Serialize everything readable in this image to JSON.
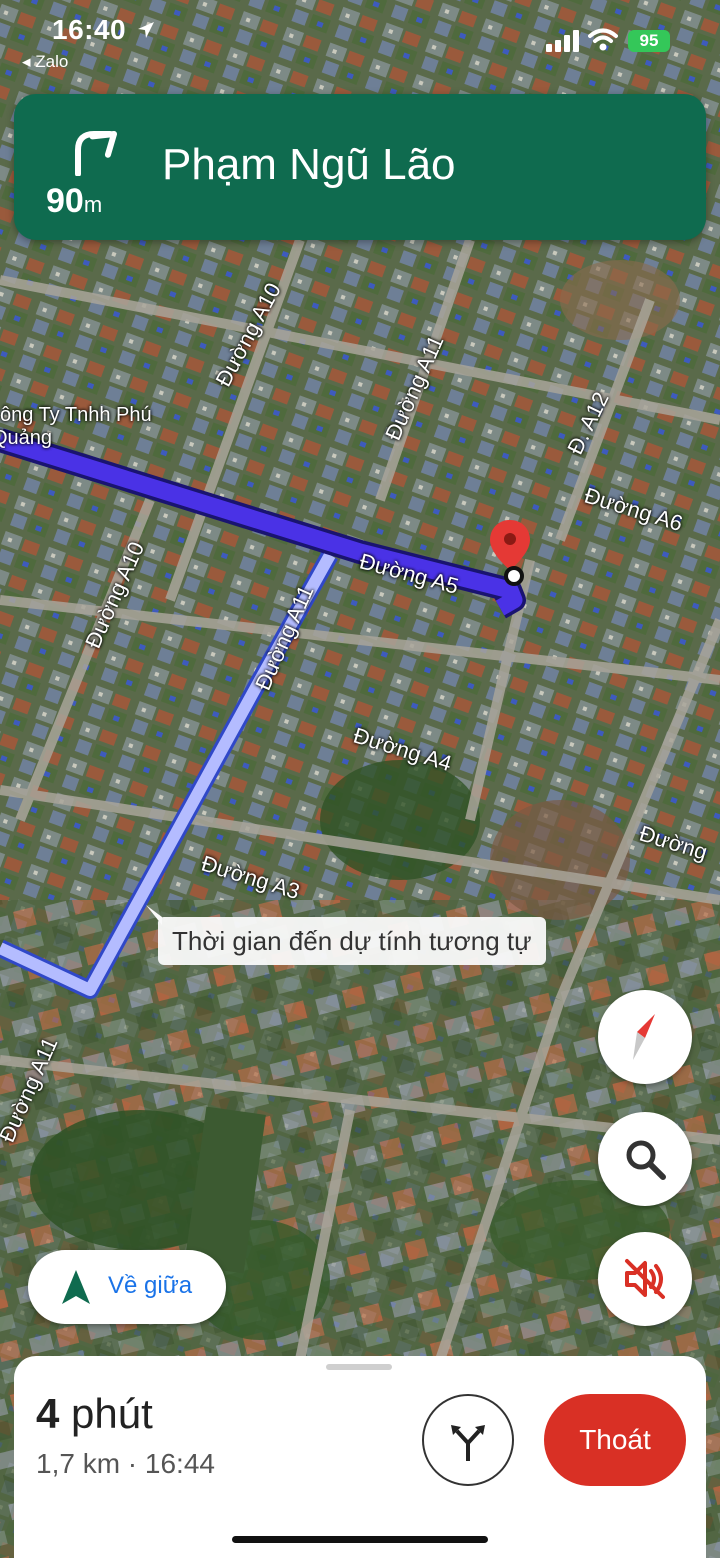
{
  "status_bar": {
    "time": "16:40",
    "back_app": "◂ Zalo",
    "battery": "95"
  },
  "navigation": {
    "distance_value": "90",
    "distance_unit": "m",
    "street": "Phạm Ngũ Lão",
    "turn_icon": "turn-right-arrow-icon"
  },
  "map": {
    "road_labels": [
      "Đường A10",
      "Đường A11",
      "Đ. A12",
      "Đường A6",
      "Đường A5",
      "Đường A10",
      "Đường A11",
      "Đường A4",
      "Đường",
      "Đường A3",
      "Đường A11"
    ],
    "place_label_line1": "ông Ty Tnhh Phú",
    "place_label_line2": "Quảng",
    "tooltip": "Thời gian đến dự tính tương tự"
  },
  "controls": {
    "compass_icon": "compass-icon",
    "search_icon": "search-icon",
    "mute_icon": "sound-muted-icon",
    "recenter_label": "Về giữa"
  },
  "trip": {
    "duration_value": "4",
    "duration_unit": " phút",
    "details": "1,7 km · 16:44",
    "exit_label": "Thoát",
    "alt_routes_icon": "alternate-routes-icon"
  },
  "colors": {
    "banner": "#0f6b4f",
    "route_main": "#3b2bd8",
    "route_alt": "#a9b4ff",
    "destination_pin": "#e53935",
    "exit_button": "#d93025",
    "battery": "#34c759"
  }
}
